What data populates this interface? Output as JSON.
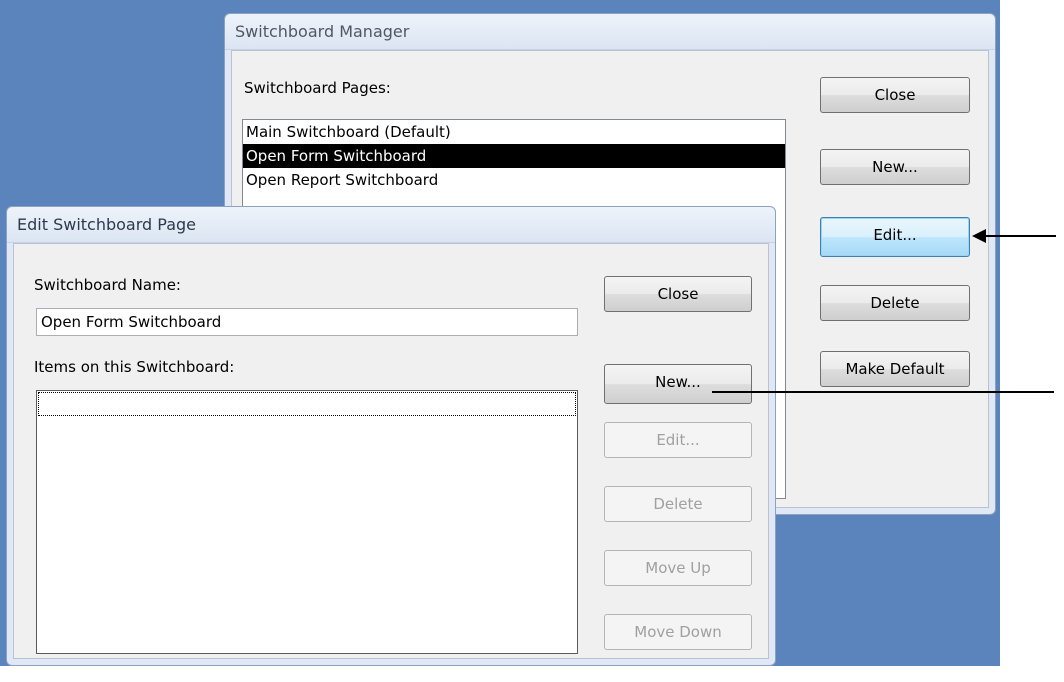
{
  "manager": {
    "title": "Switchboard Manager",
    "pages_label": "Switchboard Pages:",
    "pages": [
      {
        "label": "Main Switchboard (Default)",
        "selected": false
      },
      {
        "label": "Open Form Switchboard",
        "selected": true
      },
      {
        "label": "Open Report Switchboard",
        "selected": false
      }
    ],
    "buttons": {
      "close": "Close",
      "new": "New...",
      "edit": "Edit...",
      "delete": "Delete",
      "make_default": "Make Default"
    }
  },
  "edit_page": {
    "title": "Edit Switchboard Page",
    "name_label": "Switchboard Name:",
    "name_value": "Open Form Switchboard",
    "items_label": "Items on this Switchboard:",
    "buttons": {
      "close": "Close",
      "new": "New...",
      "edit": "Edit...",
      "delete": "Delete",
      "move_up": "Move Up",
      "move_down": "Move Down"
    }
  }
}
